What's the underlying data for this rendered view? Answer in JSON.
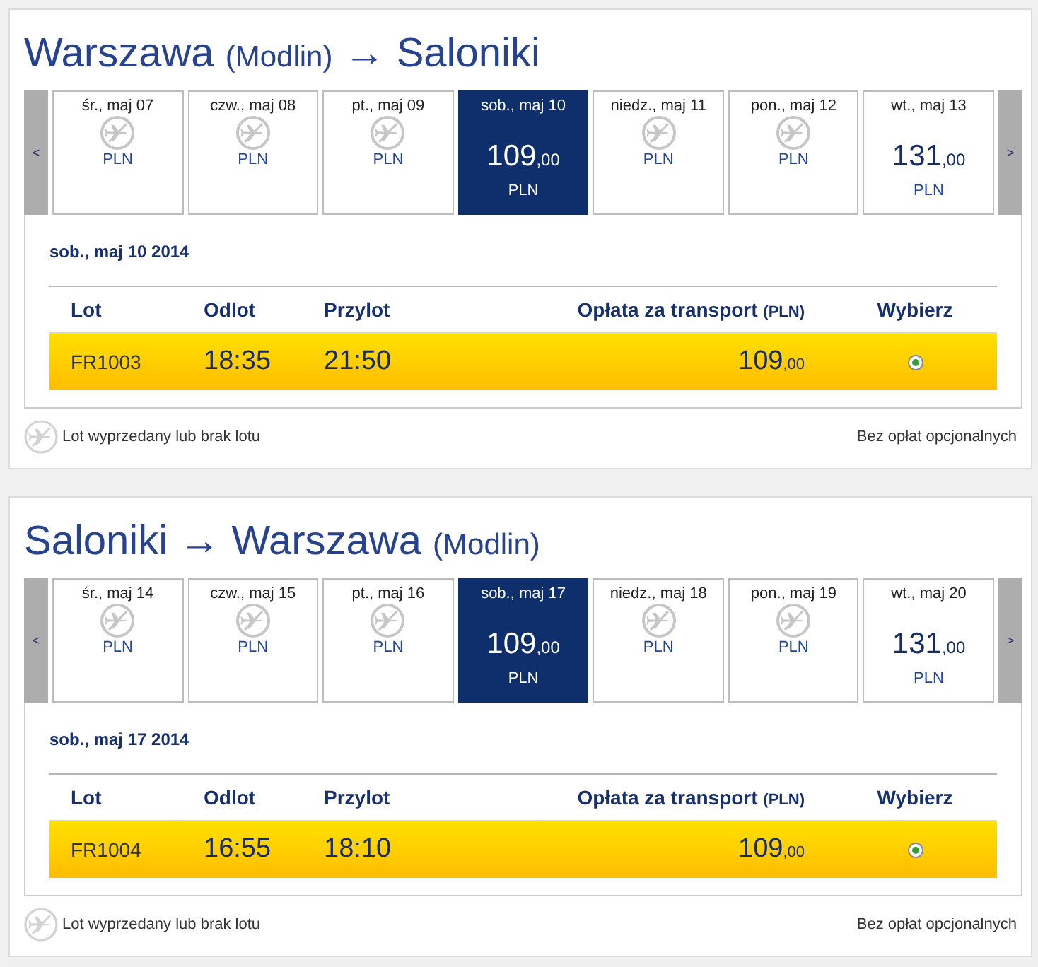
{
  "sections": [
    {
      "title_parts": [
        {
          "kind": "city",
          "text": "Warszawa"
        },
        {
          "kind": "airport",
          "text": "(Modlin)"
        },
        {
          "kind": "arrow",
          "text": "→"
        },
        {
          "kind": "city",
          "text": "Saloniki"
        }
      ],
      "date_strip": {
        "prev": "<",
        "next": ">",
        "days": [
          {
            "label": "śr., maj 07",
            "kind": "no_flight",
            "currency": "PLN",
            "selected": false
          },
          {
            "label": "czw., maj 08",
            "kind": "no_flight",
            "currency": "PLN",
            "selected": false
          },
          {
            "label": "pt., maj 09",
            "kind": "no_flight",
            "currency": "PLN",
            "selected": false
          },
          {
            "label": "sob., maj 10",
            "kind": "fare",
            "price": "109",
            "cents": ",00",
            "currency": "PLN",
            "selected": true
          },
          {
            "label": "niedz., maj 11",
            "kind": "no_flight",
            "currency": "PLN",
            "selected": false
          },
          {
            "label": "pon., maj 12",
            "kind": "no_flight",
            "currency": "PLN",
            "selected": false
          },
          {
            "label": "wt., maj 13",
            "kind": "fare",
            "price": "131",
            "cents": ",00",
            "currency": "PLN",
            "selected": false
          }
        ]
      },
      "selected_date": "sob., maj 10 2014",
      "table": {
        "columns": [
          {
            "label": "Lot"
          },
          {
            "label": "Odlot"
          },
          {
            "label": "Przylot"
          },
          {
            "label": "Opłata za transport",
            "unit": "(PLN)"
          },
          {
            "label": "Wybierz"
          }
        ],
        "rows": [
          {
            "flight": "FR1003",
            "departure": "18:35",
            "arrival": "21:50",
            "price": "109",
            "cents": ",00",
            "selected": true
          }
        ]
      },
      "legend": "Lot wyprzedany lub brak lotu",
      "fees_note": "Bez opłat opcjonalnych"
    },
    {
      "title_parts": [
        {
          "kind": "city",
          "text": "Saloniki"
        },
        {
          "kind": "arrow",
          "text": "→"
        },
        {
          "kind": "city",
          "text": "Warszawa"
        },
        {
          "kind": "airport",
          "text": "(Modlin)"
        }
      ],
      "date_strip": {
        "prev": "<",
        "next": ">",
        "days": [
          {
            "label": "śr., maj 14",
            "kind": "no_flight",
            "currency": "PLN",
            "selected": false
          },
          {
            "label": "czw., maj 15",
            "kind": "no_flight",
            "currency": "PLN",
            "selected": false
          },
          {
            "label": "pt., maj 16",
            "kind": "no_flight",
            "currency": "PLN",
            "selected": false
          },
          {
            "label": "sob., maj 17",
            "kind": "fare",
            "price": "109",
            "cents": ",00",
            "currency": "PLN",
            "selected": true
          },
          {
            "label": "niedz., maj 18",
            "kind": "no_flight",
            "currency": "PLN",
            "selected": false
          },
          {
            "label": "pon., maj 19",
            "kind": "no_flight",
            "currency": "PLN",
            "selected": false
          },
          {
            "label": "wt., maj 20",
            "kind": "fare",
            "price": "131",
            "cents": ",00",
            "currency": "PLN",
            "selected": false
          }
        ]
      },
      "selected_date": "sob., maj 17 2014",
      "table": {
        "columns": [
          {
            "label": "Lot"
          },
          {
            "label": "Odlot"
          },
          {
            "label": "Przylot"
          },
          {
            "label": "Opłata za transport",
            "unit": "(PLN)"
          },
          {
            "label": "Wybierz"
          }
        ],
        "rows": [
          {
            "flight": "FR1004",
            "departure": "16:55",
            "arrival": "18:10",
            "price": "109",
            "cents": ",00",
            "selected": true
          }
        ]
      },
      "legend": "Lot wyprzedany lub brak lotu",
      "fees_note": "Bez opłat opcjonalnych"
    }
  ]
}
